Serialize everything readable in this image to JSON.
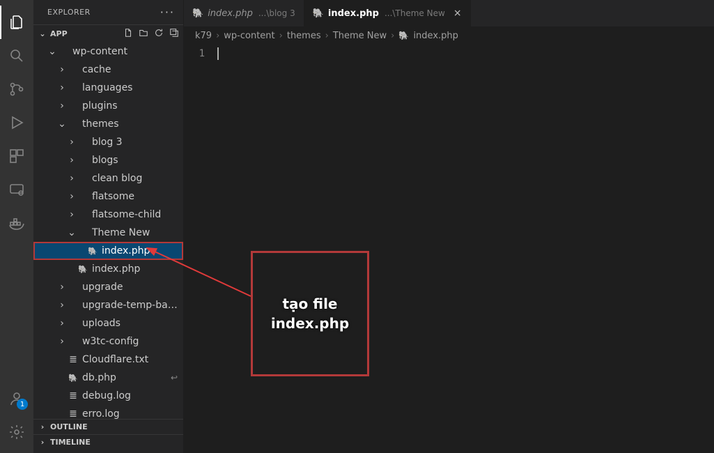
{
  "activity": {
    "account_badge": "1"
  },
  "sidebar": {
    "title": "EXPLORER",
    "sections": {
      "workspace": "APP",
      "outline": "OUTLINE",
      "timeline": "TIMELINE"
    },
    "tree": [
      {
        "depth": 1,
        "twisty": "v",
        "kind": "folder",
        "label": "wp-content"
      },
      {
        "depth": 2,
        "twisty": ">",
        "kind": "folder",
        "label": "cache"
      },
      {
        "depth": 2,
        "twisty": ">",
        "kind": "folder",
        "label": "languages"
      },
      {
        "depth": 2,
        "twisty": ">",
        "kind": "folder",
        "label": "plugins"
      },
      {
        "depth": 2,
        "twisty": "v",
        "kind": "folder",
        "label": "themes"
      },
      {
        "depth": 3,
        "twisty": ">",
        "kind": "folder",
        "label": "blog 3"
      },
      {
        "depth": 3,
        "twisty": ">",
        "kind": "folder",
        "label": "blogs"
      },
      {
        "depth": 3,
        "twisty": ">",
        "kind": "folder",
        "label": "clean blog"
      },
      {
        "depth": 3,
        "twisty": ">",
        "kind": "folder",
        "label": "flatsome"
      },
      {
        "depth": 3,
        "twisty": ">",
        "kind": "folder",
        "label": "flatsome-child"
      },
      {
        "depth": 3,
        "twisty": "v",
        "kind": "folder",
        "label": "Theme New"
      },
      {
        "depth": 4,
        "twisty": "",
        "kind": "php",
        "label": "index.php",
        "selected": true,
        "boxed": true
      },
      {
        "depth": 3,
        "twisty": "",
        "kind": "php",
        "label": "index.php"
      },
      {
        "depth": 2,
        "twisty": ">",
        "kind": "folder",
        "label": "upgrade"
      },
      {
        "depth": 2,
        "twisty": ">",
        "kind": "folder",
        "label": "upgrade-temp-backup"
      },
      {
        "depth": 2,
        "twisty": ">",
        "kind": "folder",
        "label": "uploads"
      },
      {
        "depth": 2,
        "twisty": ">",
        "kind": "folder",
        "label": "w3tc-config"
      },
      {
        "depth": 2,
        "twisty": "",
        "kind": "txt",
        "label": "Cloudflare.txt"
      },
      {
        "depth": 2,
        "twisty": "",
        "kind": "php",
        "label": "db.php",
        "dirty": true
      },
      {
        "depth": 2,
        "twisty": "",
        "kind": "log",
        "label": "debug.log"
      },
      {
        "depth": 2,
        "twisty": "",
        "kind": "log",
        "label": "erro.log"
      }
    ]
  },
  "tabs": [
    {
      "filename": "index.php",
      "hint": "...\\blog 3",
      "active": false,
      "icon": "php"
    },
    {
      "filename": "index.php",
      "hint": "...\\Theme New",
      "active": true,
      "icon": "php"
    }
  ],
  "breadcrumbs": [
    "k79",
    "wp-content",
    "themes",
    "Theme New",
    "index.php"
  ],
  "editor": {
    "line_number": "1",
    "content": ""
  },
  "annotation": {
    "text": "tạo file\nindex.php"
  }
}
